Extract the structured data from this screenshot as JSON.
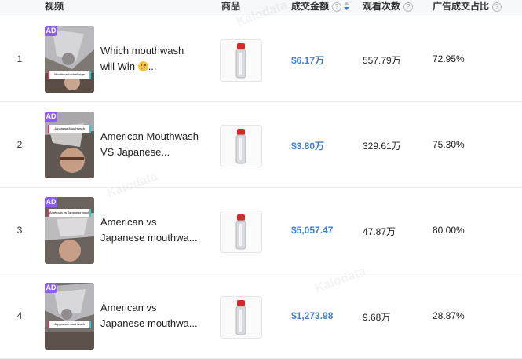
{
  "table": {
    "headers": {
      "video": "视频",
      "product": "商品",
      "amount": "成交金额",
      "views": "观看次数",
      "ad_ratio": "广告成交占比"
    },
    "help_glyph": "?",
    "ad_badge": "AD",
    "watermark": "Kalodata",
    "rows": [
      {
        "rank": "1",
        "title_line1": "Which mouthwash",
        "title_line2": "will Win",
        "title_suffix": "...",
        "caption": "Mouthwash challenge",
        "amount": "$6.17万",
        "views": "557.79万",
        "ratio": "72.95%"
      },
      {
        "rank": "2",
        "title_line1": "American Mouthwash",
        "title_line2": "VS Japanese...",
        "caption": "Japanese Mouthwash",
        "amount": "$3.80万",
        "views": "329.61万",
        "ratio": "75.30%"
      },
      {
        "rank": "3",
        "title_line1": "American vs",
        "title_line2": "Japanese mouthwa...",
        "caption": "American vs Japanese mouthwash",
        "amount": "$5,057.47",
        "views": "47.87万",
        "ratio": "80.00%"
      },
      {
        "rank": "4",
        "title_line1": "American vs",
        "title_line2": "Japanese mouthwa...",
        "caption": "Japanese mouthwash",
        "amount": "$1,273.98",
        "views": "9.68万",
        "ratio": "28.87%"
      }
    ]
  },
  "colors": {
    "amount_text": "#3f7fd0",
    "ad_badge": "#8a5cf0",
    "header_bg": "#f7f8fa",
    "row_border": "#ebedf0"
  }
}
